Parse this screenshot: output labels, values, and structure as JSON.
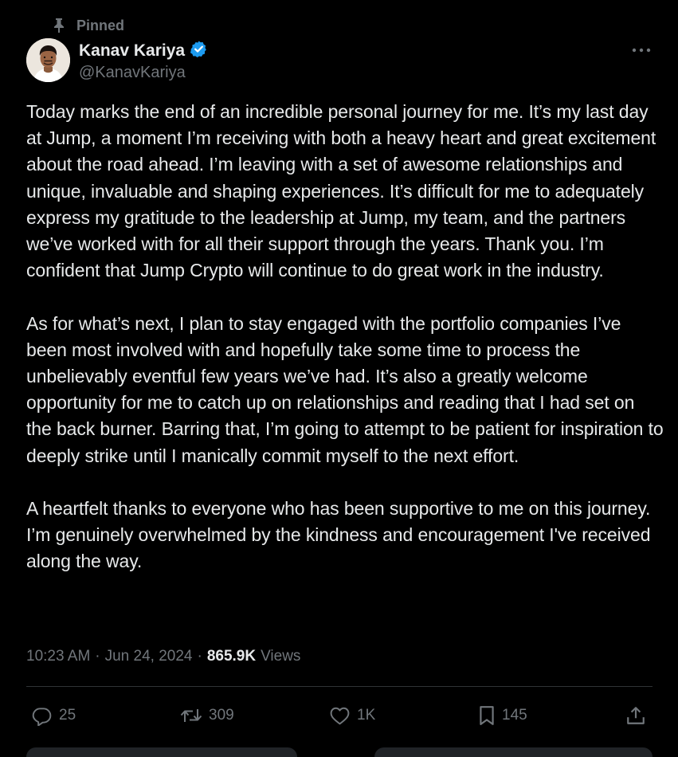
{
  "pinned_label": "Pinned",
  "author": {
    "name": "Kanav Kariya",
    "handle": "@KanavKariya",
    "verified": true
  },
  "body": {
    "paragraphs": [
      "Today marks the end of an incredible personal journey for me. It’s my last day at Jump, a moment I’m receiving with both a heavy heart and great excitement about the road ahead. I’m leaving with a set of awesome relationships and unique, invaluable and shaping experiences. It’s difficult for me to adequately express my gratitude to the leadership at Jump, my team, and the partners we’ve worked with for all their support through the years. Thank you. I’m confident that Jump Crypto will continue to do great work in the industry.",
      "As for what’s next, I plan to stay engaged with the portfolio companies I’ve been most involved with and hopefully take some time to process the unbelievably eventful few years we’ve had. It’s also a greatly welcome opportunity for me to catch up on relationships and reading that I had set on the back burner. Barring that, I’m going to attempt to be patient for inspiration to deeply strike until I manically commit myself to the next effort.",
      "A heartfelt thanks to everyone who has been supportive to me on this journey. I’m genuinely overwhelmed by the kindness and encouragement I've received along the way."
    ]
  },
  "meta": {
    "time": "10:23 AM",
    "separator": "·",
    "date": "Jun 24, 2024",
    "views_count": "865.9K",
    "views_label": "Views"
  },
  "actions": {
    "replies": "25",
    "reposts": "309",
    "likes": "1K",
    "bookmarks": "145"
  },
  "colors": {
    "background": "#000000",
    "text_primary": "#e7e9ea",
    "text_secondary": "#71767b",
    "verified_badge": "#1d9bf0",
    "divider": "#2f3336"
  },
  "icons": {
    "pinned": "pin-icon",
    "verified": "verified-badge-icon",
    "more": "more-dots-icon",
    "reply": "reply-icon",
    "repost": "repost-icon",
    "like": "heart-icon",
    "bookmark": "bookmark-icon",
    "share": "share-icon"
  }
}
